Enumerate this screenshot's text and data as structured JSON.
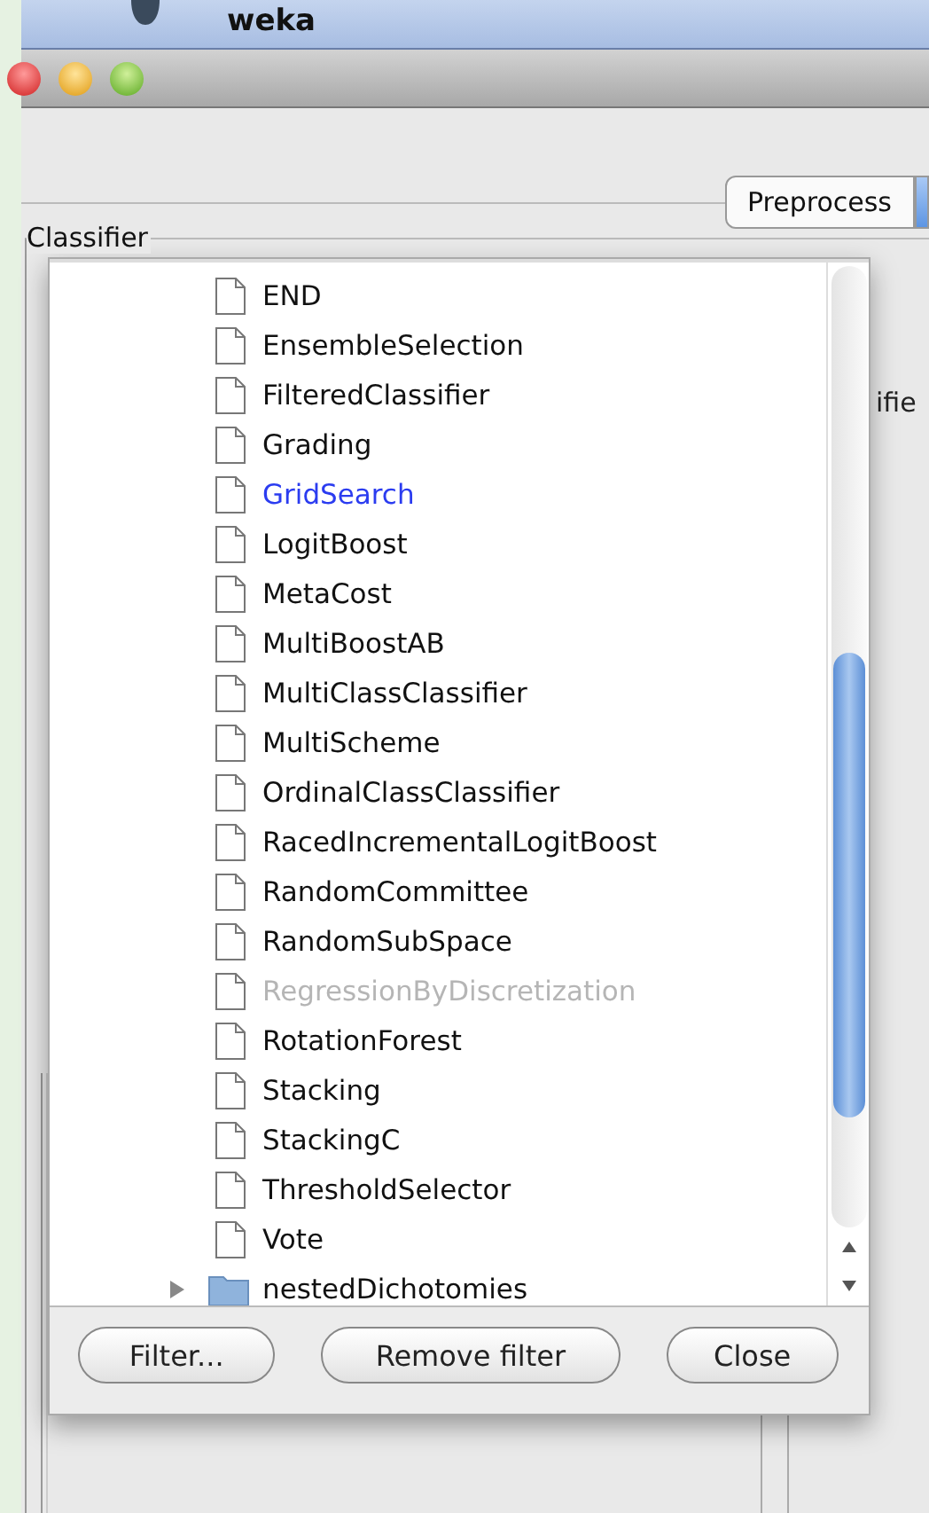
{
  "menubar": {
    "app_name": "weka"
  },
  "window": {
    "tabs": [
      {
        "label": "Preprocess",
        "selected": false
      }
    ],
    "classifier_group": {
      "title": "Classifier"
    },
    "output_group": {
      "title": "ifie"
    }
  },
  "popup": {
    "items": [
      {
        "label": "END",
        "kind": "file",
        "selected": false,
        "disabled": false
      },
      {
        "label": "EnsembleSelection",
        "kind": "file",
        "selected": false,
        "disabled": false
      },
      {
        "label": "FilteredClassifier",
        "kind": "file",
        "selected": false,
        "disabled": false
      },
      {
        "label": "Grading",
        "kind": "file",
        "selected": false,
        "disabled": false
      },
      {
        "label": "GridSearch",
        "kind": "file",
        "selected": true,
        "disabled": false
      },
      {
        "label": "LogitBoost",
        "kind": "file",
        "selected": false,
        "disabled": false
      },
      {
        "label": "MetaCost",
        "kind": "file",
        "selected": false,
        "disabled": false
      },
      {
        "label": "MultiBoostAB",
        "kind": "file",
        "selected": false,
        "disabled": false
      },
      {
        "label": "MultiClassClassifier",
        "kind": "file",
        "selected": false,
        "disabled": false
      },
      {
        "label": "MultiScheme",
        "kind": "file",
        "selected": false,
        "disabled": false
      },
      {
        "label": "OrdinalClassClassifier",
        "kind": "file",
        "selected": false,
        "disabled": false
      },
      {
        "label": "RacedIncrementalLogitBoost",
        "kind": "file",
        "selected": false,
        "disabled": false
      },
      {
        "label": "RandomCommittee",
        "kind": "file",
        "selected": false,
        "disabled": false
      },
      {
        "label": "RandomSubSpace",
        "kind": "file",
        "selected": false,
        "disabled": false
      },
      {
        "label": "RegressionByDiscretization",
        "kind": "file",
        "selected": false,
        "disabled": true
      },
      {
        "label": "RotationForest",
        "kind": "file",
        "selected": false,
        "disabled": false
      },
      {
        "label": "Stacking",
        "kind": "file",
        "selected": false,
        "disabled": false
      },
      {
        "label": "StackingC",
        "kind": "file",
        "selected": false,
        "disabled": false
      },
      {
        "label": "ThresholdSelector",
        "kind": "file",
        "selected": false,
        "disabled": false
      },
      {
        "label": "Vote",
        "kind": "file",
        "selected": false,
        "disabled": false
      },
      {
        "label": "nestedDichotomies",
        "kind": "folder",
        "selected": false,
        "disabled": false,
        "expanded": false
      }
    ],
    "buttons": [
      "Filter...",
      "Remove filter",
      "Close"
    ]
  }
}
